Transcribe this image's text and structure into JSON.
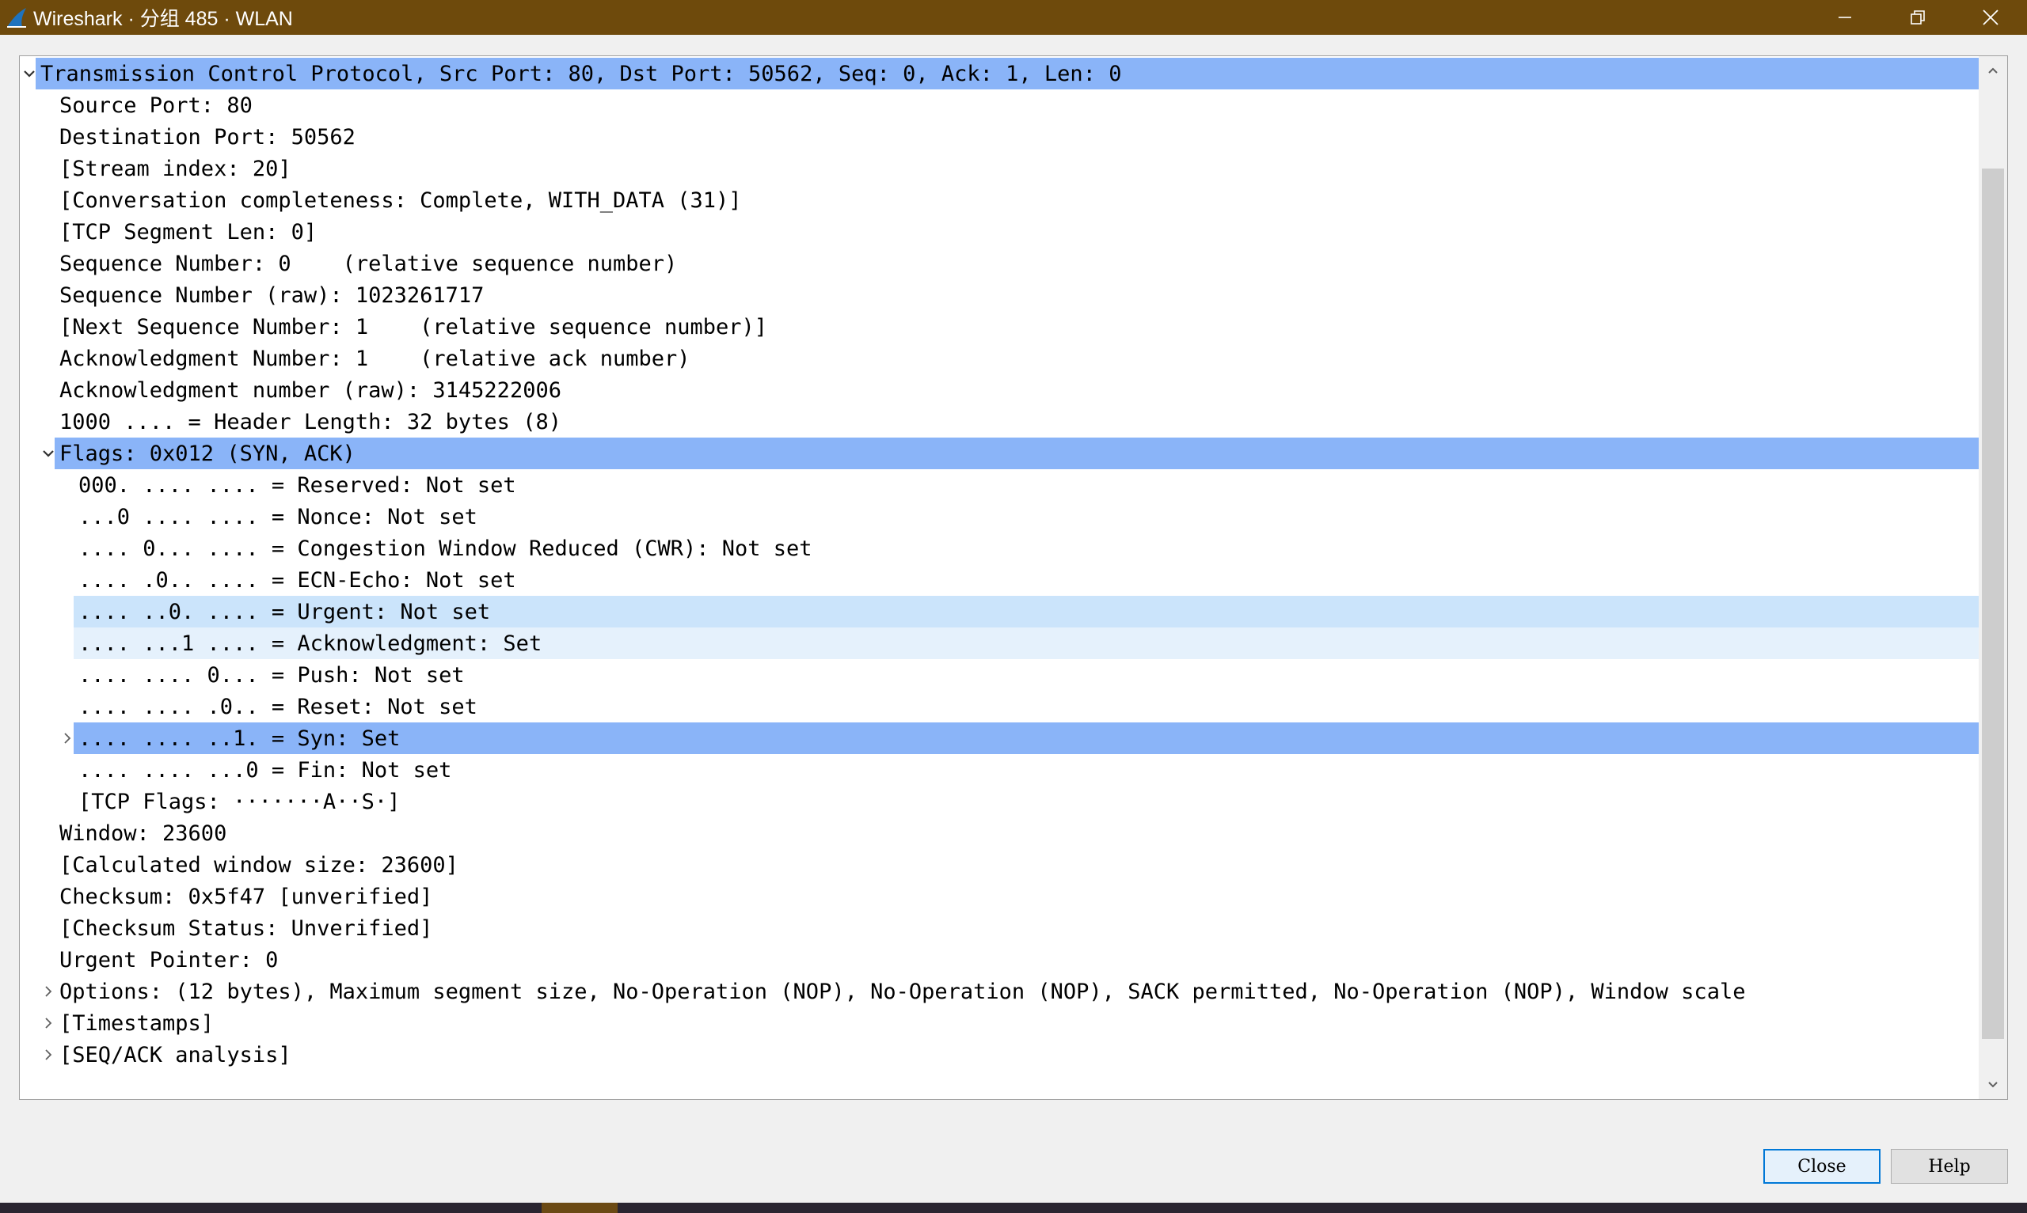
{
  "window": {
    "title": "Wireshark · 分组 485 · WLAN",
    "icon": "shark-fin-icon",
    "controls": [
      "minimize-icon",
      "restore-icon",
      "close-icon"
    ]
  },
  "tree": {
    "rows": [
      {
        "text": "Transmission Control Protocol, Src Port: 80, Dst Port: 50562, Seq: 0, Ack: 1, Len: 0",
        "level": 0,
        "toggle": "expanded",
        "highlight": "strong"
      },
      {
        "text": "Source Port: 80",
        "level": 1,
        "toggle": "none",
        "highlight": "none"
      },
      {
        "text": "Destination Port: 50562",
        "level": 1,
        "toggle": "none",
        "highlight": "none"
      },
      {
        "text": "[Stream index: 20]",
        "level": 1,
        "toggle": "none",
        "highlight": "none"
      },
      {
        "text": "[Conversation completeness: Complete, WITH_DATA (31)]",
        "level": 1,
        "toggle": "none",
        "highlight": "none"
      },
      {
        "text": "[TCP Segment Len: 0]",
        "level": 1,
        "toggle": "none",
        "highlight": "none"
      },
      {
        "text": "Sequence Number: 0    (relative sequence number)",
        "level": 1,
        "toggle": "none",
        "highlight": "none"
      },
      {
        "text": "Sequence Number (raw): 1023261717",
        "level": 1,
        "toggle": "none",
        "highlight": "none"
      },
      {
        "text": "[Next Sequence Number: 1    (relative sequence number)]",
        "level": 1,
        "toggle": "none",
        "highlight": "none"
      },
      {
        "text": "Acknowledgment Number: 1    (relative ack number)",
        "level": 1,
        "toggle": "none",
        "highlight": "none"
      },
      {
        "text": "Acknowledgment number (raw): 3145222006",
        "level": 1,
        "toggle": "none",
        "highlight": "none"
      },
      {
        "text": "1000 .... = Header Length: 32 bytes (8)",
        "level": 1,
        "toggle": "none",
        "highlight": "none"
      },
      {
        "text": "Flags: 0x012 (SYN, ACK)",
        "level": 1,
        "toggle": "expanded",
        "highlight": "strong"
      },
      {
        "text": "000. .... .... = Reserved: Not set",
        "level": 2,
        "toggle": "none",
        "highlight": "none"
      },
      {
        "text": "...0 .... .... = Nonce: Not set",
        "level": 2,
        "toggle": "none",
        "highlight": "none"
      },
      {
        "text": ".... 0... .... = Congestion Window Reduced (CWR): Not set",
        "level": 2,
        "toggle": "none",
        "highlight": "none"
      },
      {
        "text": ".... .0.. .... = ECN-Echo: Not set",
        "level": 2,
        "toggle": "none",
        "highlight": "none"
      },
      {
        "text": ".... ..0. .... = Urgent: Not set",
        "level": 2,
        "toggle": "none",
        "highlight": "mid"
      },
      {
        "text": ".... ...1 .... = Acknowledgment: Set",
        "level": 2,
        "toggle": "none",
        "highlight": "light"
      },
      {
        "text": ".... .... 0... = Push: Not set",
        "level": 2,
        "toggle": "none",
        "highlight": "none"
      },
      {
        "text": ".... .... .0.. = Reset: Not set",
        "level": 2,
        "toggle": "none",
        "highlight": "none"
      },
      {
        "text": ".... .... ..1. = Syn: Set",
        "level": 2,
        "toggle": "collapsed",
        "highlight": "strong"
      },
      {
        "text": ".... .... ...0 = Fin: Not set",
        "level": 2,
        "toggle": "none",
        "highlight": "none"
      },
      {
        "text": "[TCP Flags: ·······A··S·]",
        "level": 2,
        "toggle": "none",
        "highlight": "none"
      },
      {
        "text": "Window: 23600",
        "level": 1,
        "toggle": "none",
        "highlight": "none"
      },
      {
        "text": "[Calculated window size: 23600]",
        "level": 1,
        "toggle": "none",
        "highlight": "none"
      },
      {
        "text": "Checksum: 0x5f47 [unverified]",
        "level": 1,
        "toggle": "none",
        "highlight": "none"
      },
      {
        "text": "[Checksum Status: Unverified]",
        "level": 1,
        "toggle": "none",
        "highlight": "none"
      },
      {
        "text": "Urgent Pointer: 0",
        "level": 1,
        "toggle": "none",
        "highlight": "none"
      },
      {
        "text": "Options: (12 bytes), Maximum segment size, No-Operation (NOP), No-Operation (NOP), SACK permitted, No-Operation (NOP), Window scale",
        "level": 1,
        "toggle": "collapsed",
        "highlight": "none"
      },
      {
        "text": "[Timestamps]",
        "level": 1,
        "toggle": "collapsed",
        "highlight": "none"
      },
      {
        "text": "[SEQ/ACK analysis]",
        "level": 1,
        "toggle": "collapsed",
        "highlight": "none"
      }
    ]
  },
  "buttons": {
    "close_label": "Close",
    "help_label": "Help"
  },
  "colors": {
    "titlebar": "#6e4a0c",
    "selection_strong": "#8ab4f8",
    "selection_mid": "#cbe4fb",
    "selection_light": "#e5f1fc"
  }
}
